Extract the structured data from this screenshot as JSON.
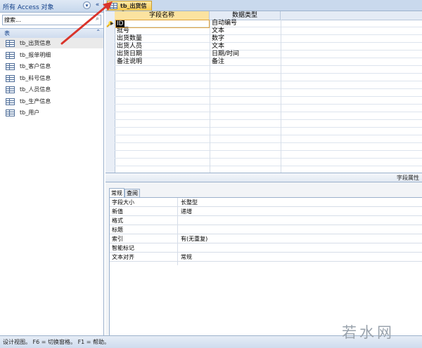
{
  "nav": {
    "title": "所有 Access 对象",
    "menu_glyph": "▾",
    "collapse_glyph": "«",
    "search_placeholder": "搜索...",
    "search_icon": "search-icon",
    "group_label": "表",
    "group_glyph": "⌃",
    "items": [
      {
        "label": "tb_出货信息",
        "selected": true
      },
      {
        "label": "tb_报单明细",
        "selected": false
      },
      {
        "label": "tb_客户信息",
        "selected": false
      },
      {
        "label": "tb_料号信息",
        "selected": false
      },
      {
        "label": "tb_人员信息",
        "selected": false
      },
      {
        "label": "tb_生产信息",
        "selected": false
      },
      {
        "label": "tb_用户",
        "selected": false
      }
    ]
  },
  "document": {
    "tab_label": "tb_出货信息",
    "columns": {
      "field_name": "字段名称",
      "data_type": "数据类型"
    },
    "current_name_edit": "ID",
    "rows": [
      {
        "name": "",
        "type": "自动编号"
      },
      {
        "name": "批号",
        "type": "文本"
      },
      {
        "name": "出货数量",
        "type": "数字"
      },
      {
        "name": "出货人员",
        "type": "文本"
      },
      {
        "name": "出货日期",
        "type": "日期/时间"
      },
      {
        "name": "备注说明",
        "type": "备注"
      }
    ]
  },
  "properties": {
    "header_title": "字段属性",
    "tabs": {
      "general": "常规",
      "lookup": "查阅"
    },
    "rows": [
      {
        "name": "字段大小",
        "value": "长整型"
      },
      {
        "name": "新值",
        "value": "递增"
      },
      {
        "name": "格式",
        "value": ""
      },
      {
        "name": "标题",
        "value": ""
      },
      {
        "name": "索引",
        "value": "有(无重复)"
      },
      {
        "name": "智能标记",
        "value": ""
      },
      {
        "name": "文本对齐",
        "value": "常规"
      }
    ]
  },
  "status": {
    "text": "设计视图。  F6 = 切换窗格。  F1 = 帮助。"
  },
  "watermark": "若水网",
  "colors": {
    "accent_tab": "#f7c84c",
    "annotation_arrow": "#d9342b",
    "pane_border": "#9bb1cc"
  }
}
